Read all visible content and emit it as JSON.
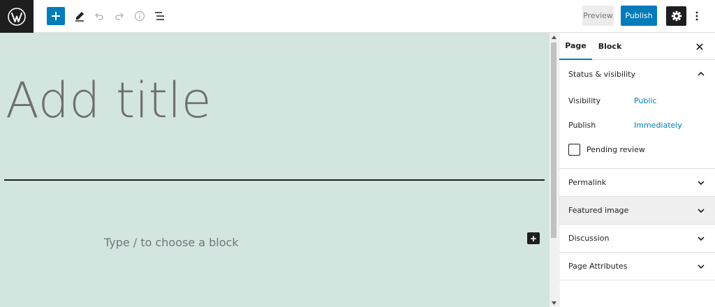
{
  "toolbar": {
    "preview_label": "Preview",
    "publish_label": "Publish",
    "icons": {
      "logo": "wordpress-logo-icon",
      "add": "plus-icon",
      "tools": "pencil-icon",
      "undo": "undo-icon",
      "redo": "redo-icon",
      "details": "info-icon",
      "outline": "list-view-icon",
      "settings": "gear-icon",
      "more": "more-vertical-icon"
    }
  },
  "editor": {
    "title_placeholder": "Add title",
    "block_placeholder": "Type / to choose a block"
  },
  "sidebar": {
    "tabs": [
      {
        "label": "Page",
        "active": true
      },
      {
        "label": "Block",
        "active": false
      }
    ],
    "status_panel": {
      "title": "Status & visibility",
      "rows": [
        {
          "label": "Visibility",
          "value": "Public"
        },
        {
          "label": "Publish",
          "value": "Immediately"
        }
      ],
      "pending_review_label": "Pending review",
      "pending_review_checked": false
    },
    "panels": [
      {
        "label": "Permalink"
      },
      {
        "label": "Featured image"
      },
      {
        "label": "Discussion"
      },
      {
        "label": "Page Attributes"
      }
    ]
  },
  "colors": {
    "accent": "#007cba",
    "canvas": "#d3e5df",
    "dark": "#1e1e1e"
  }
}
